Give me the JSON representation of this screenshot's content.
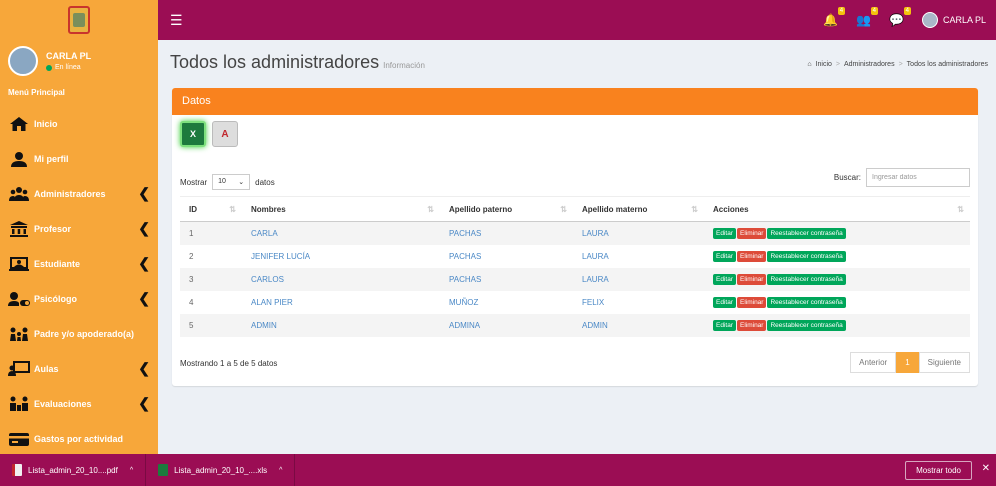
{
  "header": {
    "user_name": "CARLA PL",
    "notifications": [
      {
        "icon": "bell-icon",
        "badge": "4"
      },
      {
        "icon": "users-icon",
        "badge": "4"
      },
      {
        "icon": "comments-icon",
        "badge": "4"
      }
    ]
  },
  "sidebar": {
    "profile_name": "CARLA PL",
    "profile_status": "En línea",
    "menu_header": "Menú Principal",
    "items": [
      {
        "label": "Inicio",
        "icon": "home-icon",
        "chevron": false
      },
      {
        "label": "Mi perfil",
        "icon": "user-icon",
        "chevron": false
      },
      {
        "label": "Administradores",
        "icon": "users-icon",
        "chevron": true
      },
      {
        "label": "Profesor",
        "icon": "building-icon",
        "chevron": true
      },
      {
        "label": "Estudiante",
        "icon": "student-icon",
        "chevron": true
      },
      {
        "label": "Psicólogo",
        "icon": "user-toggle-icon",
        "chevron": true
      },
      {
        "label": "Padre y/o apoderado(a)",
        "icon": "family-icon",
        "chevron": false
      },
      {
        "label": "Aulas",
        "icon": "classroom-icon",
        "chevron": true
      },
      {
        "label": "Evaluaciones",
        "icon": "evaluations-icon",
        "chevron": true
      },
      {
        "label": "Gastos por actividad",
        "icon": "credit-card-icon",
        "chevron": false
      }
    ]
  },
  "page": {
    "title": "Todos los administradores",
    "subtitle": "Información",
    "breadcrumb": [
      "Inicio",
      "Administradores",
      "Todos los administradores"
    ]
  },
  "box": {
    "title": "Datos",
    "length_prefix": "Mostrar",
    "length_value": "10",
    "length_suffix": "datos",
    "search_label": "Buscar:",
    "search_placeholder": "Ingresar datos",
    "xls_label": "X",
    "pdf_label": "A"
  },
  "table": {
    "columns": [
      "ID",
      "Nombres",
      "Apellido paterno",
      "Apellido materno",
      "Acciones"
    ],
    "rows": [
      {
        "id": "1",
        "nombres": "CARLA",
        "paterno": "PACHAS",
        "materno": "LAURA"
      },
      {
        "id": "2",
        "nombres": "JENIFER LUCÍA",
        "paterno": "PACHAS",
        "materno": "LAURA"
      },
      {
        "id": "3",
        "nombres": "CARLOS",
        "paterno": "PACHAS",
        "materno": "LAURA"
      },
      {
        "id": "4",
        "nombres": "ALAN PIER",
        "paterno": "MUÑOZ",
        "materno": "FELIX"
      },
      {
        "id": "5",
        "nombres": "ADMIN",
        "paterno": "ADMINA",
        "materno": "ADMIN"
      }
    ],
    "actions": {
      "edit": "Editar",
      "delete": "Eliminar",
      "reset": "Reestablecer contraseña"
    },
    "info": "Mostrando 1 a 5 de 5 datos",
    "pager": {
      "prev": "Anterior",
      "current": "1",
      "next": "Siguiente"
    }
  },
  "downloads": {
    "items": [
      {
        "name": "Lista_admin_20_10....pdf",
        "type": "pdf"
      },
      {
        "name": "Lista_admin_20_10_....xls",
        "type": "xls"
      }
    ],
    "show_all": "Mostrar todo"
  },
  "colors": {
    "topbar": "#9b0d54",
    "sidebar": "#f7a73a",
    "box_header": "#f9821e",
    "success": "#00a65a",
    "danger": "#dd4b39"
  }
}
